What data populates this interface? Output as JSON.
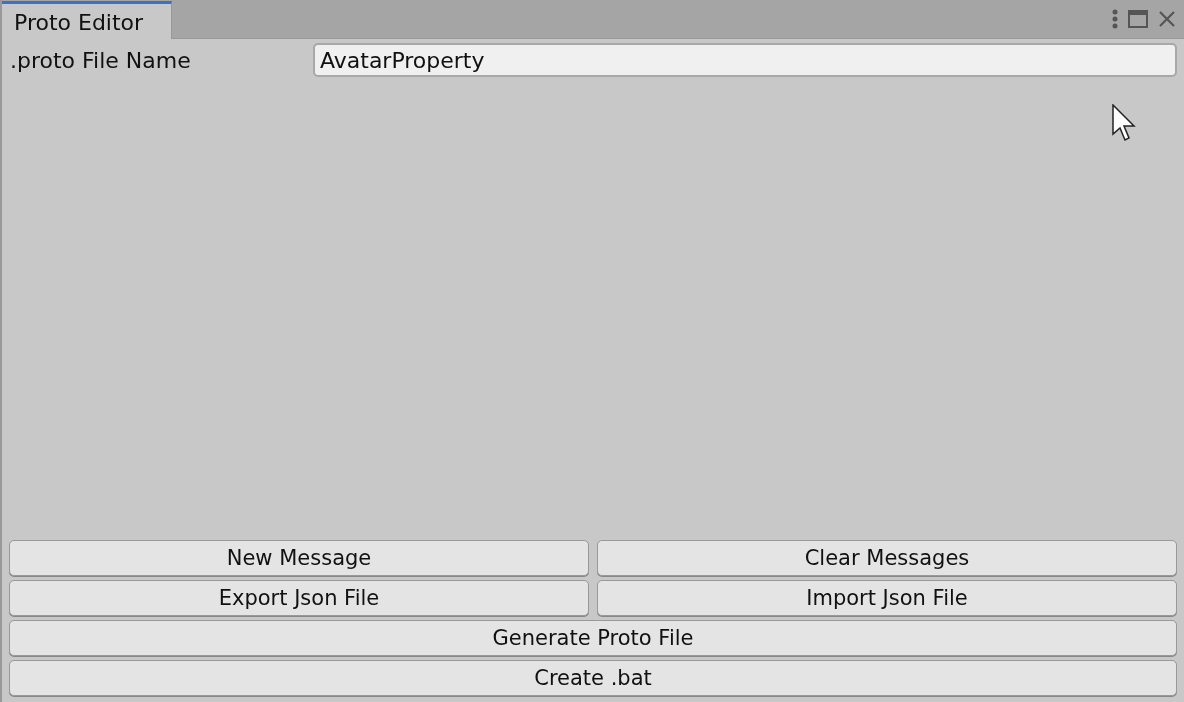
{
  "tabs": [
    {
      "label": "Proto Editor",
      "selected": true
    }
  ],
  "file_name": {
    "label": ".proto File Name",
    "value": "AvatarProperty"
  },
  "button_rows": [
    [
      "New Message",
      "Clear Messages"
    ],
    [
      "Export Json File",
      "Import Json File"
    ],
    [
      "Generate Proto File"
    ],
    [
      "Create .bat"
    ]
  ]
}
